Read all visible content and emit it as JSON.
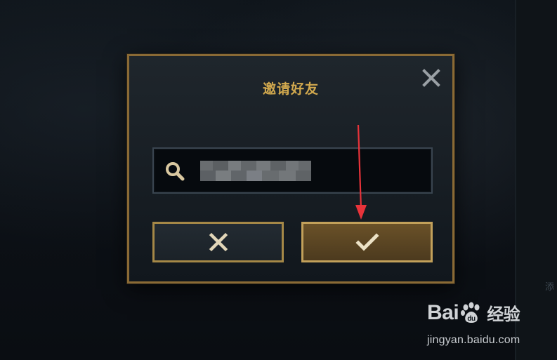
{
  "dialog": {
    "title": "邀请好友",
    "close_icon": "close-icon",
    "search": {
      "icon": "search-icon",
      "value": "",
      "placeholder": "",
      "value_obscured": true
    },
    "cancel_button": {
      "icon": "x-icon"
    },
    "confirm_button": {
      "icon": "checkmark-icon"
    }
  },
  "annotation": {
    "arrow_color": "#e8333a"
  },
  "side_panel": {
    "text": "添"
  },
  "watermark": {
    "logo_left": "Bai",
    "logo_mid": "du",
    "logo_right": "经验",
    "url": "jingyan.baidu.com"
  },
  "colors": {
    "gold": "#d2a94e",
    "frame": "#8a6a35",
    "confirm_fill": "#5a4423"
  }
}
